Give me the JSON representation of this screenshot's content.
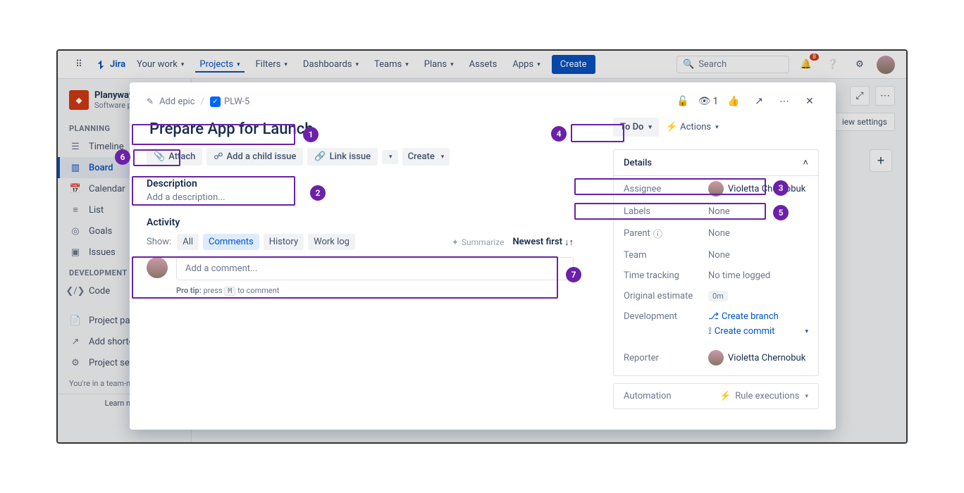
{
  "topbar": {
    "brand": "Jira",
    "nav": [
      "Your work",
      "Projects",
      "Filters",
      "Dashboards",
      "Teams",
      "Plans",
      "Assets",
      "Apps"
    ],
    "create": "Create",
    "search_placeholder": "Search",
    "notif_count": "8"
  },
  "sidebar": {
    "project_name": "Planyway",
    "project_type": "Software pr...",
    "sections": {
      "planning": "PLANNING",
      "development": "DEVELOPMENT"
    },
    "items_planning": [
      "Timeline",
      "Board",
      "Calendar",
      "List",
      "Goals",
      "Issues"
    ],
    "items_dev": [
      "Code"
    ],
    "items_bottom": [
      "Project pag...",
      "Add shortc...",
      "Project set..."
    ],
    "team_note": "You're in a team-m...",
    "learn_more": "Learn more"
  },
  "board": {
    "view_settings": "iew settings"
  },
  "modal": {
    "breadcrumb": {
      "add_epic": "Add epic",
      "issue_key": "PLW-5"
    },
    "watch_count": "1",
    "title": "Prepare App for Launch",
    "actions": {
      "attach": "Attach",
      "child_issue": "Add a child issue",
      "link": "Link issue",
      "create": "Create"
    },
    "description_label": "Description",
    "description_placeholder": "Add a description...",
    "activity_label": "Activity",
    "show_label": "Show:",
    "tabs": [
      "All",
      "Comments",
      "History",
      "Work log"
    ],
    "summarize": "Summarize",
    "sort": "Newest first",
    "comment_placeholder": "Add a comment...",
    "pro_tip_prefix": "Pro tip:",
    "pro_tip_press": "press",
    "pro_tip_key": "M",
    "pro_tip_suffix": "to comment",
    "status": "To Do",
    "actions_label": "Actions",
    "details_label": "Details",
    "fields": {
      "assignee_label": "Assignee",
      "assignee_value": "Violetta Chernobuk",
      "labels_label": "Labels",
      "labels_value": "None",
      "parent_label": "Parent",
      "parent_value": "None",
      "team_label": "Team",
      "team_value": "None",
      "time_label": "Time tracking",
      "time_value": "No time logged",
      "estimate_label": "Original estimate",
      "estimate_value": "0m",
      "dev_label": "Development",
      "dev_branch": "Create branch",
      "dev_commit": "Create commit",
      "reporter_label": "Reporter",
      "reporter_value": "Violetta Chernobuk"
    },
    "automation_label": "Automation",
    "automation_value": "Rule executions"
  },
  "annotations": [
    "1",
    "2",
    "3",
    "4",
    "5",
    "6",
    "7"
  ]
}
